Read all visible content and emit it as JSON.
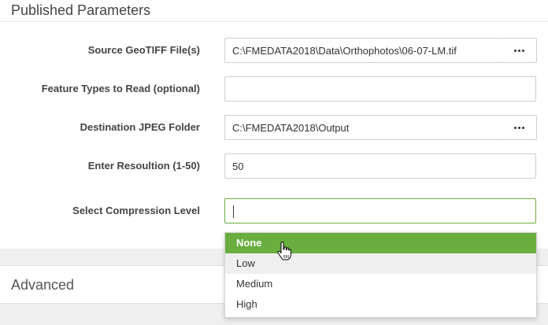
{
  "section": {
    "title": "Published Parameters"
  },
  "params": [
    {
      "label": "Source GeoTIFF File(s)",
      "value": "C:\\FMEDATA2018\\Data\\Orthophotos\\06-07-LM.tif"
    },
    {
      "label": "Feature Types to Read (optional)",
      "value": ""
    },
    {
      "label": "Destination JPEG Folder",
      "value": "C:\\FMEDATA2018\\Output"
    },
    {
      "label": "Enter Resoultion (1-50)",
      "value": "50"
    },
    {
      "label": "Select Compression Level",
      "value": ""
    }
  ],
  "dropdown": {
    "options": [
      "None",
      "Low",
      "Medium",
      "High"
    ],
    "selected": "None"
  },
  "advanced": {
    "label": "Advanced"
  },
  "colors": {
    "accent": "#6aae3f",
    "hover": "#efefef"
  }
}
